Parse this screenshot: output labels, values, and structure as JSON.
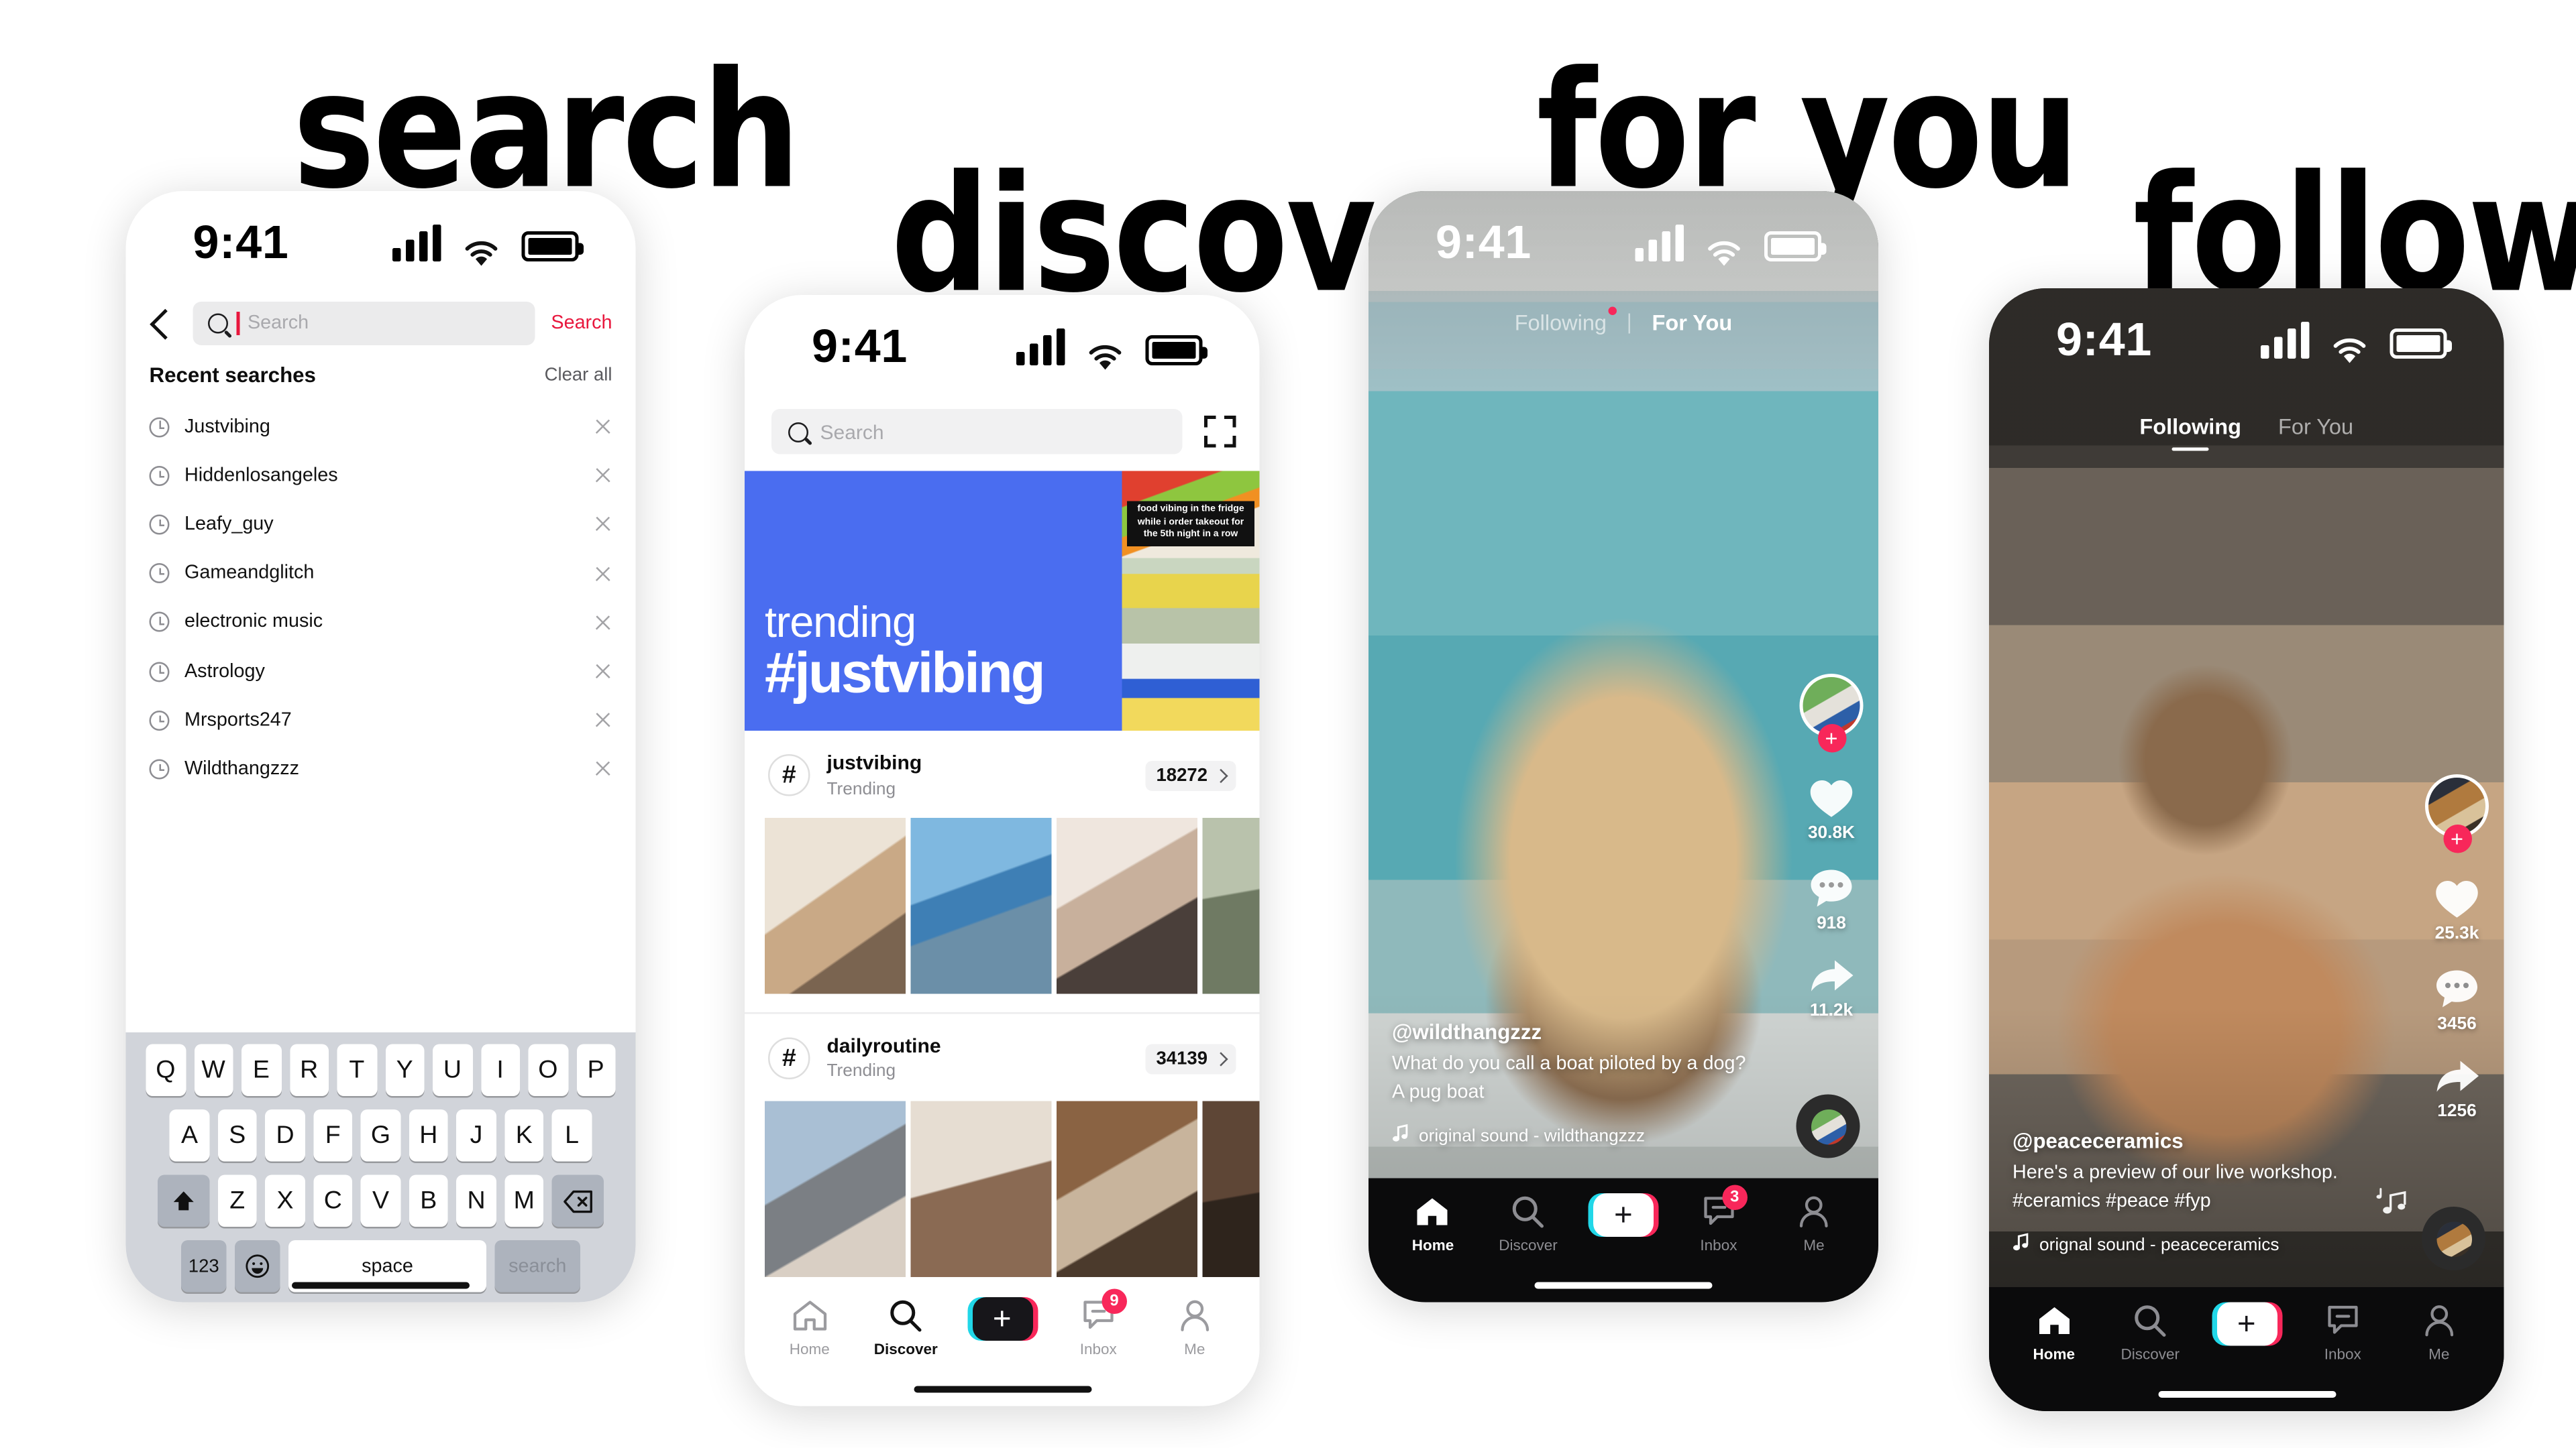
{
  "labels": {
    "search": "search",
    "discover": "discover",
    "for_you": "for you",
    "following": "following"
  },
  "status_bar": {
    "time": "9:41"
  },
  "search_screen": {
    "back_icon": "chevron-left-icon",
    "search_placeholder": "Search",
    "search_value": "",
    "search_action": "Search",
    "recent_title": "Recent searches",
    "clear_all": "Clear all",
    "recent_items": [
      "Justvibing",
      "Hiddenlosangeles",
      "Leafy_guy",
      "Gameandglitch",
      "electronic music",
      "Astrology",
      "Mrsports247",
      "Wildthangzzz"
    ],
    "keyboard": {
      "row1": [
        "Q",
        "W",
        "E",
        "R",
        "T",
        "Y",
        "U",
        "I",
        "O",
        "P"
      ],
      "row2": [
        "A",
        "S",
        "D",
        "F",
        "G",
        "H",
        "J",
        "K",
        "L"
      ],
      "row3": [
        "Z",
        "X",
        "C",
        "V",
        "B",
        "N",
        "M"
      ],
      "shift": "shift-icon",
      "backspace": "backspace-icon",
      "numbers": "123",
      "emoji": "emoji-icon",
      "space": "space",
      "go": "search",
      "globe": "globe-icon",
      "dictation": "microphone-icon"
    }
  },
  "discover_screen": {
    "search_placeholder": "Search",
    "scan_icon": "qr-scan-icon",
    "banner": {
      "kicker": "trending",
      "hashtag": "#justvibing",
      "bg_color": "#4a6df0",
      "thumb_caption": "food vibing in the fridge while i order takeout for the 5th night in a row"
    },
    "hashtags": [
      {
        "name": "justvibing",
        "subtitle": "Trending",
        "count": "18272"
      },
      {
        "name": "dailyroutine",
        "subtitle": "Trending",
        "count": "34139"
      }
    ],
    "nav": {
      "items": [
        {
          "label": "Home",
          "icon": "home-icon",
          "active": false
        },
        {
          "label": "Discover",
          "icon": "search-icon",
          "active": true
        },
        {
          "label": "Inbox",
          "icon": "inbox-icon",
          "active": false,
          "badge": "9"
        },
        {
          "label": "Me",
          "icon": "person-icon",
          "active": false
        }
      ],
      "create_label": "+"
    }
  },
  "foryou_screen": {
    "tabs": [
      {
        "label": "Following",
        "active": false,
        "dot": true
      },
      {
        "label": "For You",
        "active": true,
        "dot": false
      }
    ],
    "username": "@wildthangzzz",
    "caption_line1": "What do you call a boat piloted by a dog?",
    "caption_line2": "A pug boat",
    "sound": "original sound - wildthangzzz",
    "actions": {
      "likes": "30.8K",
      "comments": "918",
      "shares": "11.2k"
    },
    "follow_button": "+",
    "nav": {
      "items": [
        {
          "label": "Home",
          "icon": "home-icon",
          "active": true
        },
        {
          "label": "Discover",
          "icon": "search-icon",
          "active": false
        },
        {
          "label": "Inbox",
          "icon": "inbox-icon",
          "active": false,
          "badge": "3"
        },
        {
          "label": "Me",
          "icon": "person-icon",
          "active": false
        }
      ],
      "create_label": "+"
    }
  },
  "following_screen": {
    "tabs": [
      {
        "label": "Following",
        "active": true,
        "dot": false
      },
      {
        "label": "For You",
        "active": false,
        "dot": false
      }
    ],
    "username": "@peaceceramics",
    "caption_line1": "Here's a preview of our live workshop.",
    "caption_line2": "#ceramics #peace #fyp",
    "sound": "orignal sound - peaceceramics",
    "actions": {
      "likes": "25.3k",
      "comments": "3456",
      "shares": "1256"
    },
    "follow_button": "+",
    "nav": {
      "items": [
        {
          "label": "Home",
          "icon": "home-icon",
          "active": true
        },
        {
          "label": "Discover",
          "icon": "search-icon",
          "active": false
        },
        {
          "label": "Inbox",
          "icon": "inbox-icon",
          "active": false
        },
        {
          "label": "Me",
          "icon": "person-icon",
          "active": false
        }
      ],
      "create_label": "+"
    }
  },
  "colors": {
    "accent_red": "#e8173d",
    "badge_red": "#f8275a",
    "cyan": "#21d7e8",
    "banner_blue": "#4a6df0"
  }
}
